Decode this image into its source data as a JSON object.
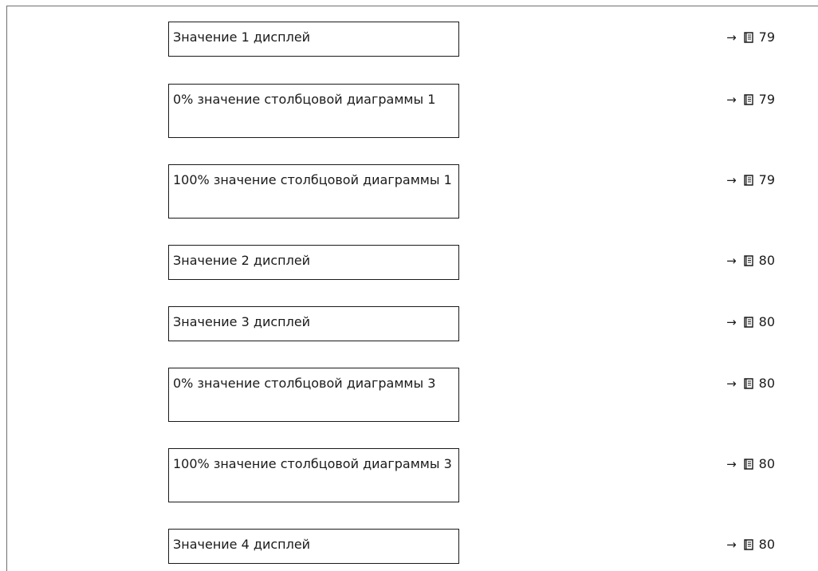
{
  "parameters": [
    {
      "label": "Значение 1 дисплей",
      "arrow": "→",
      "page": "79"
    },
    {
      "label": "0% значение столбцовой диаграммы 1",
      "arrow": "→",
      "page": "79"
    },
    {
      "label": "100% значение столбцовой диаграммы 1",
      "arrow": "→",
      "page": "79"
    },
    {
      "label": "Значение 2 дисплей",
      "arrow": "→",
      "page": "80"
    },
    {
      "label": "Значение 3 дисплей",
      "arrow": "→",
      "page": "80"
    },
    {
      "label": "0% значение столбцовой диаграммы 3",
      "arrow": "→",
      "page": "80"
    },
    {
      "label": "100% значение столбцовой диаграммы 3",
      "arrow": "→",
      "page": "80"
    },
    {
      "label": "Значение 4 дисплей",
      "arrow": "→",
      "page": "80"
    }
  ],
  "icons": {
    "page_reference": "book-icon"
  }
}
